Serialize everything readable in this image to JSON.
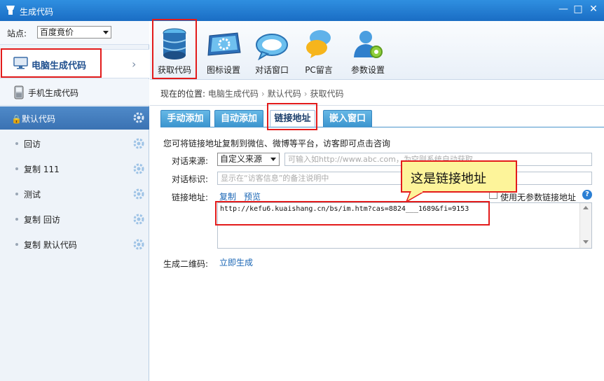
{
  "window": {
    "title": "生成代码",
    "controls": [
      "—",
      "□",
      "✕"
    ]
  },
  "site": {
    "label": "站点:",
    "selected": "百度竟价"
  },
  "sidebar": {
    "pc_label": "电脑生成代码",
    "mobile_label": "手机生成代码",
    "default_label": "默认代码",
    "sub_items": [
      {
        "label": "回访"
      },
      {
        "label": "复制 111"
      },
      {
        "label": "测试"
      },
      {
        "label": "复制 回访"
      },
      {
        "label": "复制 默认代码"
      }
    ]
  },
  "toolbar": {
    "items": [
      {
        "label": "获取代码",
        "icon": "database-icon"
      },
      {
        "label": "图标设置",
        "icon": "monitor-gear-icon"
      },
      {
        "label": "对话窗口",
        "icon": "chat-bubble-icon"
      },
      {
        "label": "PC留言",
        "icon": "speech-bubbles-icon"
      },
      {
        "label": "参数设置",
        "icon": "user-settings-icon"
      }
    ]
  },
  "breadcrumb": {
    "prefix": "现在的位置:",
    "items": [
      "电脑生成代码",
      "默认代码",
      "获取代码"
    ]
  },
  "tabs": [
    {
      "label": "手动添加"
    },
    {
      "label": "自动添加"
    },
    {
      "label": "链接地址"
    },
    {
      "label": "嵌入窗口"
    }
  ],
  "form": {
    "description": "您可将链接地址复制到微信、微博等平台，访客即可点击咨询",
    "source_label": "对话来源:",
    "source_selected": "自定义来源",
    "source_placeholder": "可输入如http://www.abc.com，为空则系统自动获取",
    "identity_label": "对话标识:",
    "identity_placeholder": "显示在“访客信息”的备注说明中",
    "link_label": "链接地址:",
    "copy_link": "复制",
    "preview_link": "预览",
    "no_param_label": "使用无参数链接地址",
    "help_glyph": "?",
    "link_value": "http://kefu6.kuaishang.cn/bs/im.htm?cas=8824___1689&fi=9153",
    "qr_label": "生成二维码:",
    "qr_link": "立即生成"
  },
  "callout": {
    "text": "这是链接地址"
  },
  "colors": {
    "titlebar": "#1a6dc4",
    "highlight": "#e31b1b",
    "callout_bg": "#fdf49a",
    "link": "#1a66b5"
  }
}
